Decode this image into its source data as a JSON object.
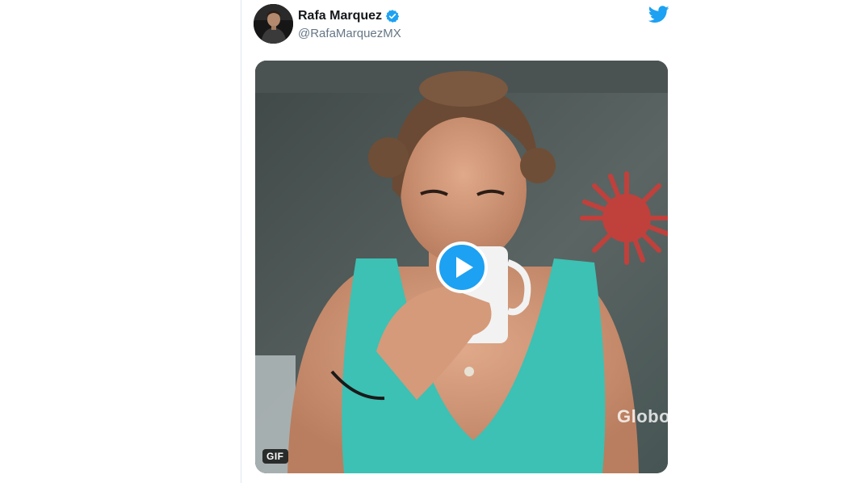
{
  "tweet": {
    "author": {
      "display_name": "Rafa Marquez",
      "handle": "@RafaMarquezMX",
      "verified": true,
      "avatar_icon": "profile-photo"
    },
    "brand_icon": "twitter-bird-icon",
    "colors": {
      "accent": "#1da1f2",
      "name": "#14171a",
      "handle": "#657786"
    },
    "media": {
      "type": "gif",
      "badge_label": "GIF",
      "watermark_text": "Globo",
      "play_icon": "play-icon"
    }
  }
}
